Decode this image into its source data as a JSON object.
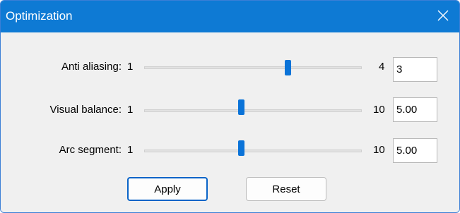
{
  "window": {
    "title": "Optimization"
  },
  "sliders": [
    {
      "label": "Anti aliasing:",
      "min": "1",
      "max": "4",
      "value": "3",
      "position": 0.667
    },
    {
      "label": "Visual balance:",
      "min": "1",
      "max": "10",
      "value": "5.00",
      "position": 0.444
    },
    {
      "label": "Arc segment:",
      "min": "1",
      "max": "10",
      "value": "5.00",
      "position": 0.444
    }
  ],
  "buttons": {
    "apply": "Apply",
    "reset": "Reset"
  },
  "icons": {
    "close": "close-icon"
  },
  "colors": {
    "titlebar": "#0e7ad4",
    "accent": "#0a73d8",
    "background": "#f0f0f0"
  }
}
